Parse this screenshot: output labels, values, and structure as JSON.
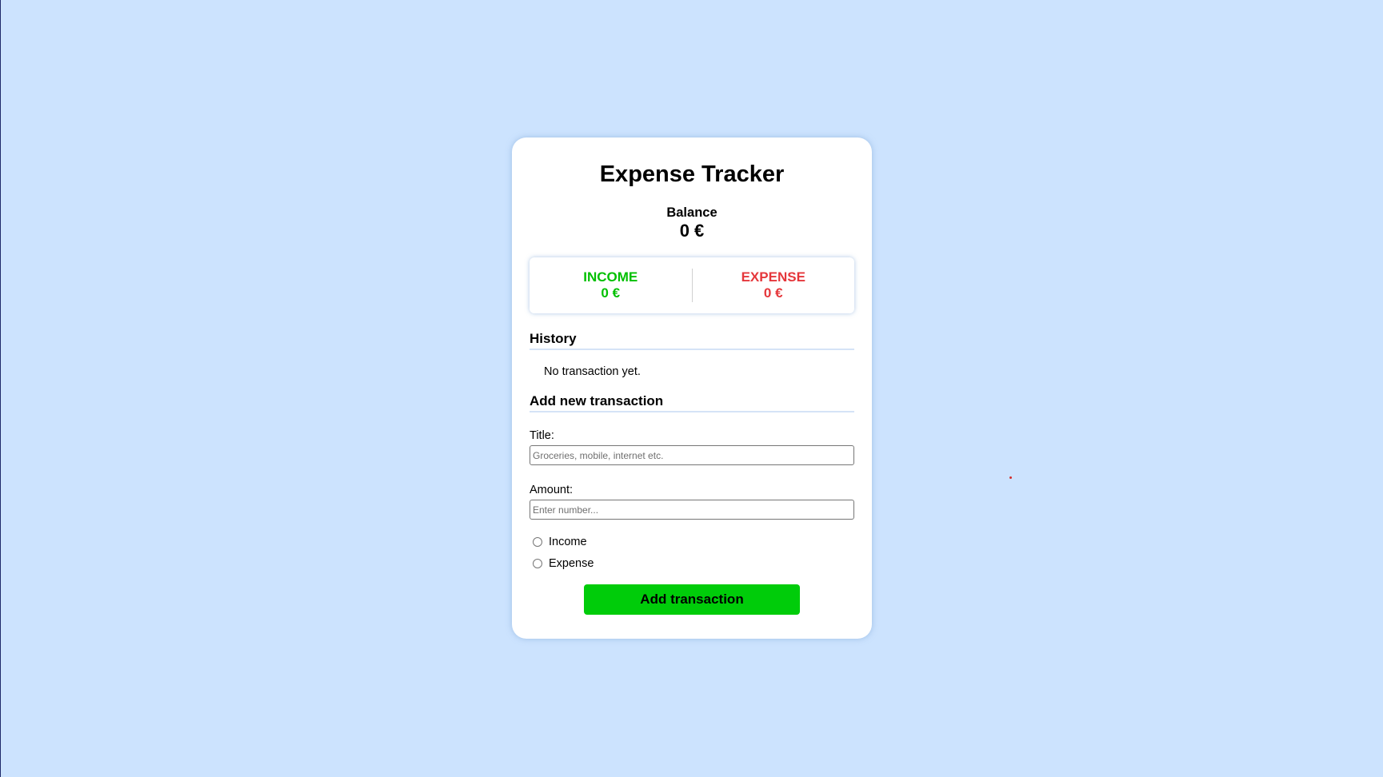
{
  "app": {
    "title": "Expense Tracker"
  },
  "balance": {
    "label": "Balance",
    "value": "0 €"
  },
  "summary": {
    "income_label": "INCOME",
    "income_value": "0 €",
    "expense_label": "EXPENSE",
    "expense_value": "0 €"
  },
  "history": {
    "title": "History",
    "empty_text": "No transaction yet."
  },
  "form": {
    "title": "Add new transaction",
    "title_label": "Title:",
    "title_placeholder": "Groceries, mobile, internet etc.",
    "title_value": "",
    "amount_label": "Amount:",
    "amount_placeholder": "Enter number...",
    "amount_value": "",
    "type_options": [
      "Income",
      "Expense"
    ],
    "submit_label": "Add transaction"
  },
  "colors": {
    "background": "#cce3fe",
    "income": "#00c000",
    "expense": "#e5373b",
    "button": "#00cc0a"
  }
}
